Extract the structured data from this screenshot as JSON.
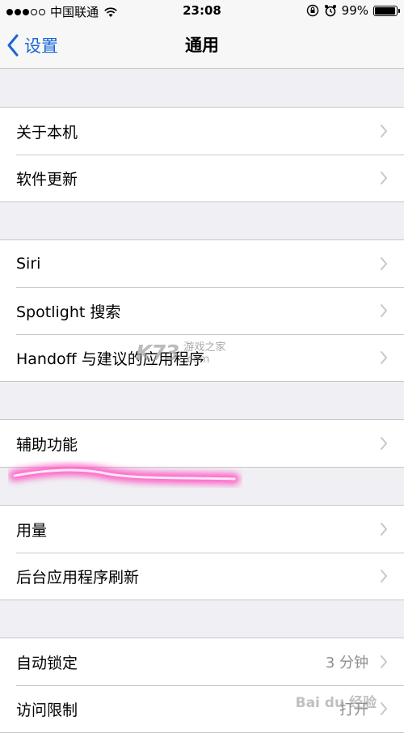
{
  "status_bar": {
    "carrier": "中国联通",
    "time": "23:08",
    "battery_percent": "99%",
    "signal_bars": 3
  },
  "nav": {
    "back_label": "设置",
    "title": "通用"
  },
  "group1": {
    "rows": [
      {
        "label": "关于本机"
      },
      {
        "label": "软件更新"
      }
    ]
  },
  "group2": {
    "rows": [
      {
        "label": "Siri"
      },
      {
        "label": "Spotlight 搜索"
      },
      {
        "label": "Handoff 与建议的应用程序"
      }
    ]
  },
  "group3": {
    "rows": [
      {
        "label": "辅助功能"
      }
    ]
  },
  "group4": {
    "rows": [
      {
        "label": "用量"
      },
      {
        "label": "后台应用程序刷新"
      }
    ]
  },
  "group5": {
    "rows": [
      {
        "label": "自动锁定",
        "value": "3 分钟"
      },
      {
        "label": "访问限制",
        "value": "打开"
      }
    ]
  },
  "watermark": {
    "logo": "K73",
    "line1": "游戏之家",
    "line2": ".com"
  },
  "baidu_mark": "Bai du 经验",
  "colors": {
    "accent": "#1a66d6",
    "background": "#efeff4",
    "separator": "#c8c7cc",
    "highlight": "#ff4fc0"
  }
}
